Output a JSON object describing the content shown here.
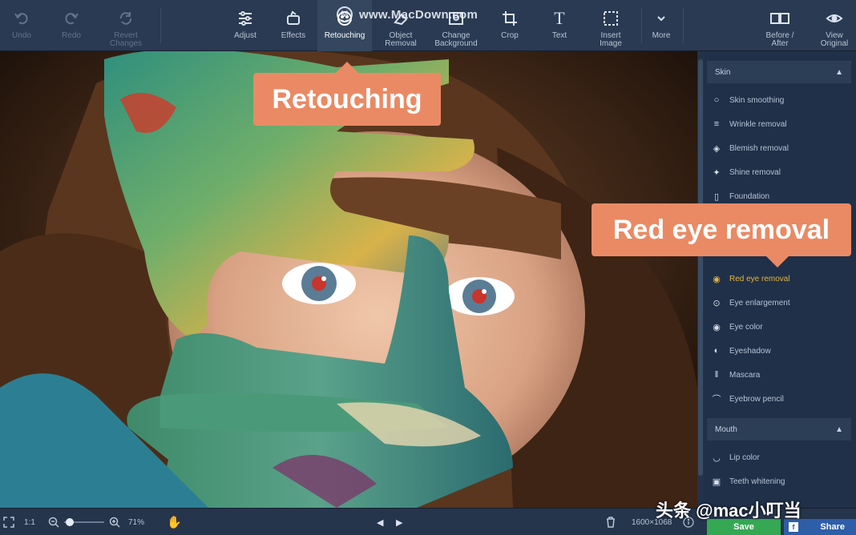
{
  "toolbar": {
    "undo": "Undo",
    "redo": "Redo",
    "revert": "Revert\nChanges",
    "adjust": "Adjust",
    "effects": "Effects",
    "retouching": "Retouching",
    "object_removal": "Object\nRemoval",
    "change_background": "Change\nBackground",
    "crop": "Crop",
    "text": "Text",
    "insert_image": "Insert\nImage",
    "more": "More",
    "before_after": "Before /\nAfter",
    "view_original": "View\nOriginal"
  },
  "watermark": "www.MacDown.com",
  "callouts": {
    "retouching": "Retouching",
    "red_eye": "Red eye removal"
  },
  "panel": {
    "skin_header": "Skin",
    "skin_items": [
      "Skin smoothing",
      "Wrinkle removal",
      "Blemish removal",
      "Shine removal",
      "Foundation"
    ],
    "eye_items": [
      "Red eye removal",
      "Eye enlargement",
      "Eye color",
      "Eyeshadow",
      "Mascara",
      "Eyebrow pencil"
    ],
    "mouth_header": "Mouth",
    "mouth_items": [
      "Lip color",
      "Teeth whitening"
    ]
  },
  "bottom": {
    "one_to_one": "1:1",
    "zoom": "71%",
    "dimensions": "1600×1068",
    "save": "Save",
    "share": "Share"
  },
  "credit": "头条 @mac小叮当",
  "colors": {
    "accent_callout": "#ea8a64",
    "active_item": "#e3b53c",
    "save": "#34a853",
    "share": "#2e5ea8"
  }
}
